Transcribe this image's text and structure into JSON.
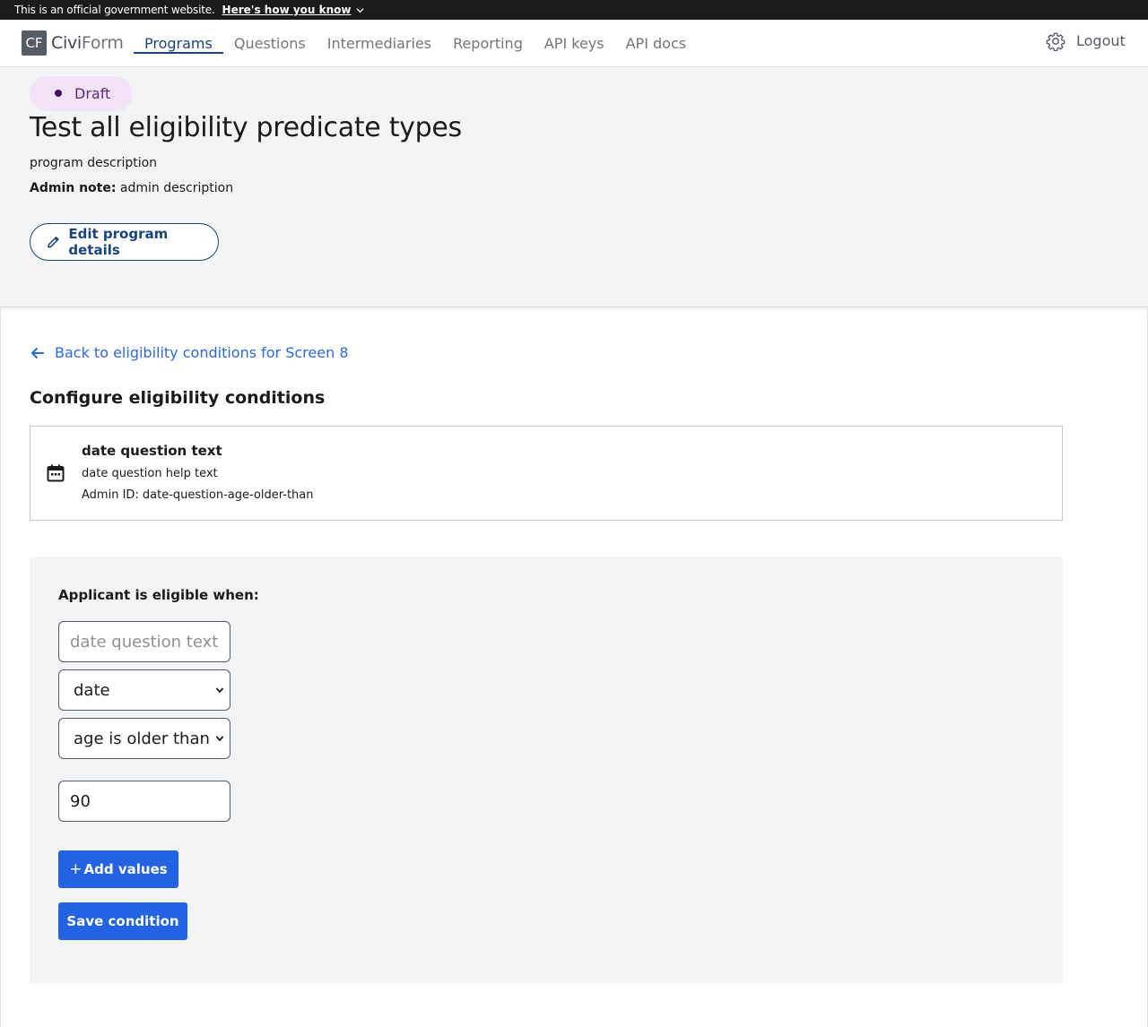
{
  "gov_banner": {
    "official_text": "This is an official government website.",
    "how_link": "Here's how you know"
  },
  "nav": {
    "logo_mark": "CF",
    "logo_civi": "Civi",
    "logo_form": "Form",
    "links": [
      {
        "label": "Programs"
      },
      {
        "label": "Questions"
      },
      {
        "label": "Intermediaries"
      },
      {
        "label": "Reporting"
      },
      {
        "label": "API keys"
      },
      {
        "label": "API docs"
      }
    ],
    "active_link": "Programs",
    "settings_icon": "gear-icon",
    "logout_label": "Logout"
  },
  "program": {
    "status_badge": "Draft",
    "title": "Test all eligibility predicate types",
    "description": "program description",
    "admin_note_label": "Admin note:",
    "admin_note_value": "admin description",
    "edit_button": "Edit program details"
  },
  "main": {
    "back_link": "Back to eligibility conditions for Screen 8",
    "section_title": "Configure eligibility conditions",
    "question": {
      "icon": "calendar-icon",
      "title": "date question text",
      "help_text": "date question help text",
      "admin_id": "Admin ID: date-question-age-older-than"
    },
    "condition": {
      "label": "Applicant is eligible when:",
      "question_placeholder": "date question text",
      "scalar_selected": "date",
      "operator_selected": "age is older than",
      "value": "90",
      "add_values_button": "Add values",
      "save_button": "Save condition"
    }
  },
  "colors": {
    "primary": "#2363e3",
    "link": "#2b6ad8",
    "nav_active": "#1a4480",
    "badge_bg": "#f3e3f8",
    "header_bg": "#f3f4f6"
  }
}
